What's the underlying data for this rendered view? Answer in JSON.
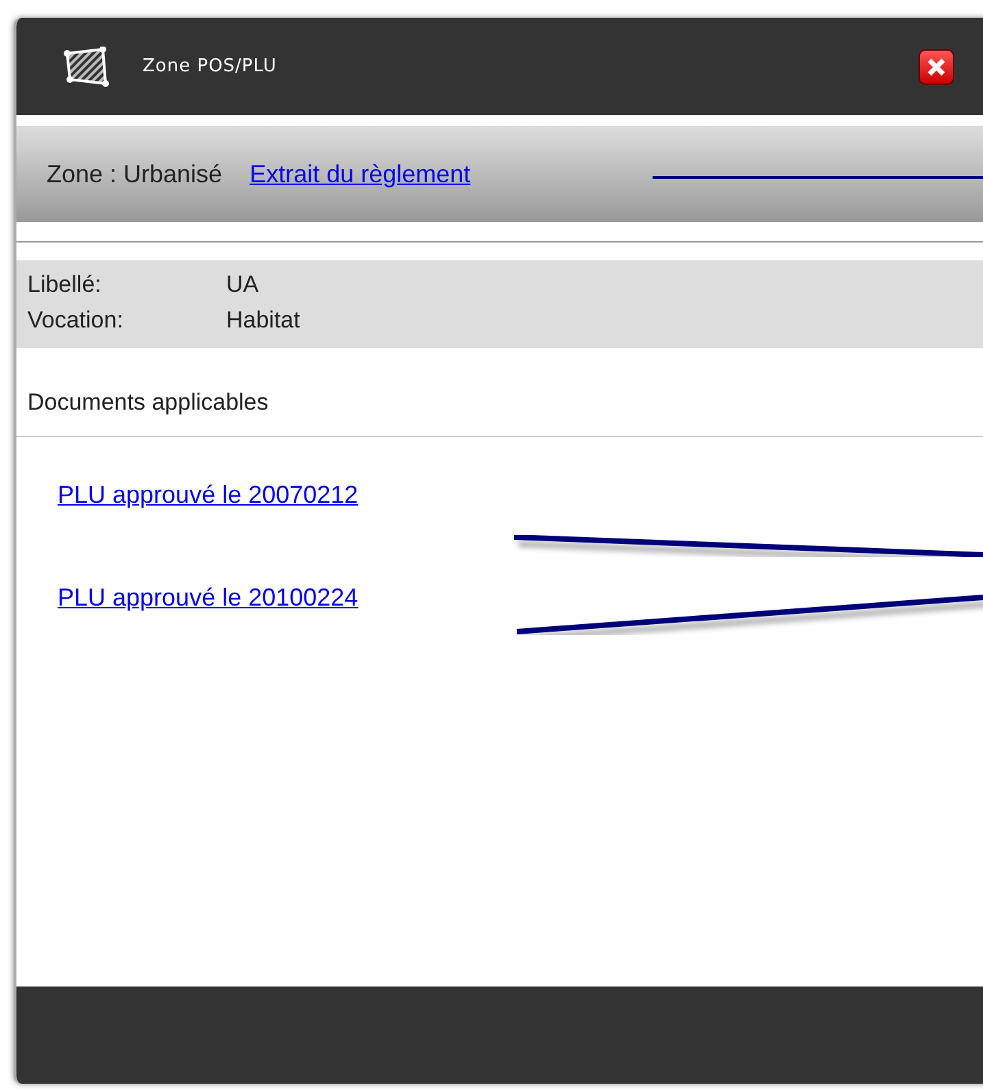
{
  "window": {
    "title": "Zone POS/PLU"
  },
  "header": {
    "zone_label": "Zone : Urbanisé",
    "link": "Extrait du règlement"
  },
  "fields": [
    {
      "label": "Libellé:",
      "value": "UA"
    },
    {
      "label": "Vocation:",
      "value": "Habitat"
    }
  ],
  "documents": {
    "heading": "Documents applicables",
    "links": [
      "PLU approuvé le 20070212",
      "PLU approuvé le 20100224"
    ]
  }
}
